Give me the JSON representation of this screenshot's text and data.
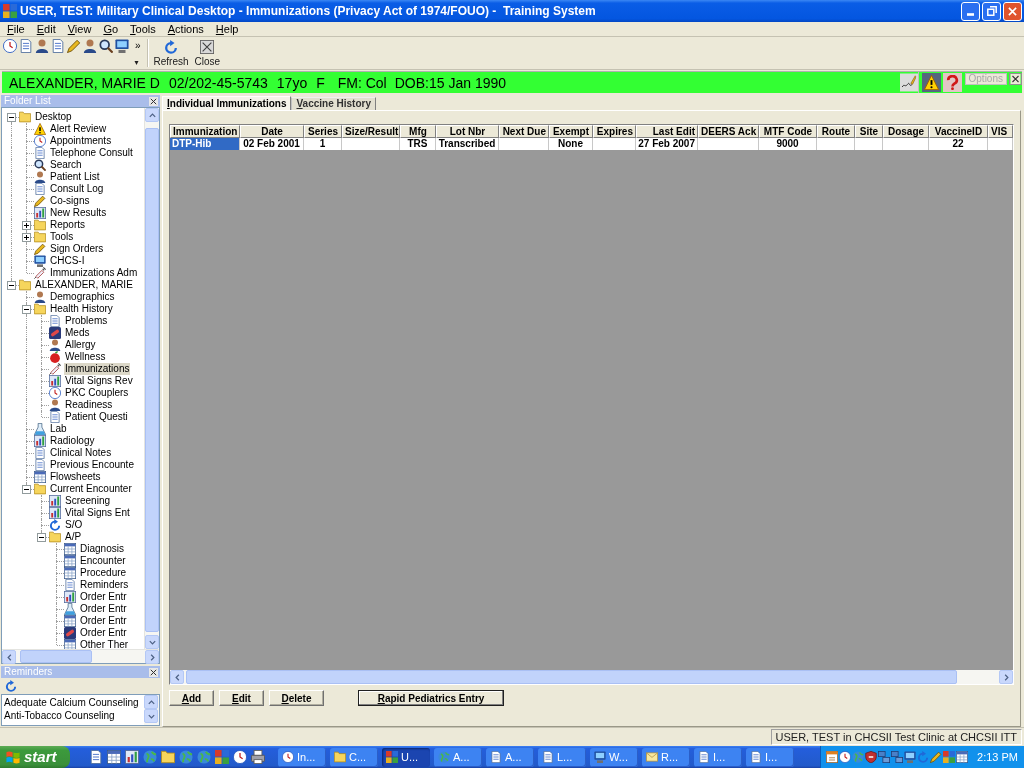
{
  "window": {
    "title": "USER, TEST: Military Clinical Desktop - Immunizations (Privacy Act of 1974/FOUO) -  Training System"
  },
  "menu": [
    "File",
    "Edit",
    "View",
    "Go",
    "Tools",
    "Actions",
    "Help"
  ],
  "toolbar": {
    "overflow": "»",
    "buttons": [
      {
        "label": "Refresh",
        "kind": "refresh"
      },
      {
        "label": "Close",
        "kind": "close"
      }
    ]
  },
  "patient_bar": {
    "name": "ALEXANDER, MARIE D",
    "id": "02/202-45-5743",
    "age": "17yo",
    "sex": "F",
    "fmp": "FM: Col",
    "dob": "DOB:15 Jan 1990",
    "options_button": {
      "label": "Options",
      "disabled": true
    }
  },
  "folder_list": {
    "title": "Folder List",
    "tree": [
      {
        "label": "Desktop",
        "kind": "folder",
        "expanded": true,
        "selected": false,
        "children": [
          {
            "label": "Alert Review",
            "kind": "item",
            "selected": false
          },
          {
            "label": "Appointments",
            "kind": "item",
            "selected": false
          },
          {
            "label": "Telephone Consult",
            "kind": "item",
            "selected": false
          },
          {
            "label": "Search",
            "kind": "item",
            "selected": false
          },
          {
            "label": "Patient List",
            "kind": "item",
            "selected": false
          },
          {
            "label": "Consult Log",
            "kind": "item",
            "selected": false
          },
          {
            "label": "Co-signs",
            "kind": "item",
            "selected": false
          },
          {
            "label": "New Results",
            "kind": "item",
            "selected": false
          },
          {
            "label": "Reports",
            "kind": "folder",
            "expanded": false,
            "selected": false
          },
          {
            "label": "Tools",
            "kind": "folder",
            "expanded": false,
            "selected": false
          },
          {
            "label": "Sign Orders",
            "kind": "item",
            "selected": false
          },
          {
            "label": "CHCS-I",
            "kind": "item",
            "selected": false
          },
          {
            "label": "Immunizations Adm",
            "kind": "item",
            "selected": false
          }
        ]
      },
      {
        "label": "ALEXANDER, MARIE",
        "kind": "folder",
        "expanded": true,
        "selected": false,
        "children": [
          {
            "label": "Demographics",
            "kind": "item",
            "selected": false
          },
          {
            "label": "Health History",
            "kind": "folder",
            "expanded": true,
            "selected": false,
            "children": [
              {
                "label": "Problems",
                "kind": "item",
                "selected": false
              },
              {
                "label": "Meds",
                "kind": "item",
                "selected": false
              },
              {
                "label": "Allergy",
                "kind": "item",
                "selected": false
              },
              {
                "label": "Wellness",
                "kind": "item",
                "selected": false
              },
              {
                "label": "Immunizations",
                "kind": "item",
                "selected": true
              },
              {
                "label": "Vital Signs Rev",
                "kind": "item",
                "selected": false
              },
              {
                "label": "PKC Couplers",
                "kind": "item",
                "selected": false
              },
              {
                "label": "Readiness",
                "kind": "item",
                "selected": false
              },
              {
                "label": "Patient Questi",
                "kind": "item",
                "selected": false
              }
            ]
          },
          {
            "label": "Lab",
            "kind": "item",
            "selected": false
          },
          {
            "label": "Radiology",
            "kind": "item",
            "selected": false
          },
          {
            "label": "Clinical Notes",
            "kind": "item",
            "selected": false
          },
          {
            "label": "Previous Encounte",
            "kind": "item",
            "selected": false
          },
          {
            "label": "Flowsheets",
            "kind": "item",
            "selected": false
          },
          {
            "label": "Current Encounter",
            "kind": "folder",
            "expanded": true,
            "selected": false,
            "children": [
              {
                "label": "Screening",
                "kind": "item",
                "selected": false
              },
              {
                "label": "Vital Signs Ent",
                "kind": "item",
                "selected": false
              },
              {
                "label": "S/O",
                "kind": "item",
                "selected": false
              },
              {
                "label": "A/P",
                "kind": "folder",
                "expanded": true,
                "selected": false,
                "children": [
                  {
                    "label": "Diagnosis",
                    "kind": "item",
                    "selected": false
                  },
                  {
                    "label": "Encounter",
                    "kind": "item",
                    "selected": false
                  },
                  {
                    "label": "Procedure",
                    "kind": "item",
                    "selected": false
                  },
                  {
                    "label": "Reminders",
                    "kind": "item",
                    "selected": false
                  },
                  {
                    "label": "Order Entr",
                    "kind": "item",
                    "selected": false
                  },
                  {
                    "label": "Order Entr",
                    "kind": "item",
                    "selected": false
                  },
                  {
                    "label": "Order Entr",
                    "kind": "item",
                    "selected": false
                  },
                  {
                    "label": "Order Entr",
                    "kind": "item",
                    "selected": false
                  },
                  {
                    "label": "Other Ther",
                    "kind": "item",
                    "selected": false
                  }
                ]
              }
            ]
          }
        ]
      }
    ]
  },
  "reminders": {
    "title": "Reminders",
    "items": [
      "Adequate Calcium Counseling",
      "Anti-Tobacco Counseling"
    ]
  },
  "tabs": [
    {
      "label": "Individual Immunizations",
      "selected": true
    },
    {
      "label": "Vaccine History",
      "selected": false
    }
  ],
  "table": {
    "columns": [
      "Immunization",
      "Date",
      "Series",
      "Size/Result",
      "Mfg",
      "Lot Nbr",
      "Next Due",
      "Exempt",
      "Expires",
      "Last Edit",
      "DEERS Ack",
      "MTF Code",
      "Route",
      "Site",
      "Dosage",
      "VaccineID",
      "VIS"
    ],
    "rows": [
      {
        "selected": true,
        "cells": [
          "DTP-Hib",
          "02 Feb 2001",
          "1",
          null,
          "TRS",
          "Transcribed",
          null,
          "None",
          null,
          "27 Feb 2007",
          null,
          "9000",
          null,
          null,
          null,
          "22",
          null
        ]
      }
    ]
  },
  "buttons": [
    {
      "label": "Add",
      "default": false
    },
    {
      "label": "Edit",
      "default": false
    },
    {
      "label": "Delete",
      "default": false
    },
    {
      "label": "Rapid Pediatrics Entry",
      "default": true
    }
  ],
  "status_bar": {
    "text": "USER, TEST in CHCSII Test Clinic at CHCSII ITT"
  },
  "taskbar": {
    "start": "start",
    "tasks": [
      {
        "label": "In...",
        "selected": false
      },
      {
        "label": "C...",
        "selected": false
      },
      {
        "label": "U...",
        "selected": true
      },
      {
        "label": "A...",
        "selected": false
      },
      {
        "label": "A...",
        "selected": false
      },
      {
        "label": "L...",
        "selected": false
      },
      {
        "label": "W...",
        "selected": false
      },
      {
        "label": "R...",
        "selected": false
      },
      {
        "label": "I...",
        "selected": false
      },
      {
        "label": "I...",
        "selected": false
      }
    ],
    "clock": "2:13 PM"
  }
}
